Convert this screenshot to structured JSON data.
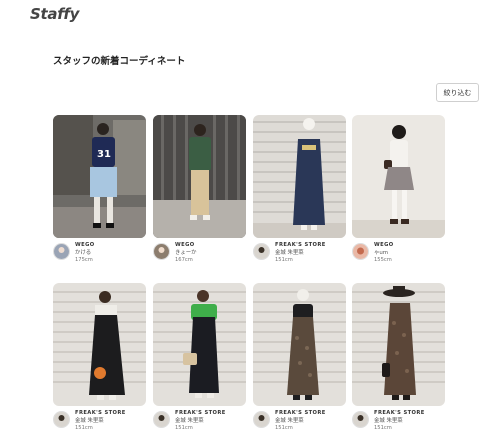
{
  "header": {
    "logo_text": "Staffy"
  },
  "page": {
    "title": "スタッフの新着コーディネート"
  },
  "toolbar": {
    "filter_label": "絞り込む"
  },
  "colors": {
    "text": "#333333",
    "border": "#cfcfcf",
    "background": "#ffffff"
  },
  "cards": [
    {
      "brand": "WEGO",
      "staff": "かける",
      "height": "175cm"
    },
    {
      "brand": "WEGO",
      "staff": "きょーか",
      "height": "167cm"
    },
    {
      "brand": "FREAK'S STORE",
      "staff": "金城 朱里菜",
      "height": "151cm"
    },
    {
      "brand": "WEGO",
      "staff": "ゃum",
      "height": "155cm"
    },
    {
      "brand": "FREAK'S STORE",
      "staff": "金城 朱里菜",
      "height": "151cm"
    },
    {
      "brand": "FREAK'S STORE",
      "staff": "金城 朱里菜",
      "height": "151cm"
    },
    {
      "brand": "FREAK'S STORE",
      "staff": "金城 朱里菜",
      "height": "151cm"
    },
    {
      "brand": "FREAK'S STORE",
      "staff": "金城 朱里菜",
      "height": "151cm"
    }
  ]
}
